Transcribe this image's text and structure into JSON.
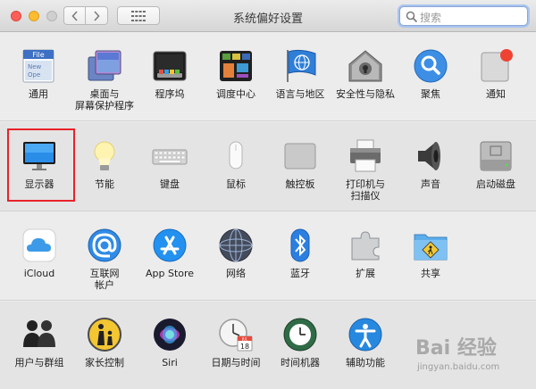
{
  "window": {
    "title": "系统偏好设置"
  },
  "toolbar": {
    "search_placeholder": "搜索"
  },
  "sections": [
    [
      {
        "label": "通用",
        "icon": "general-icon"
      },
      {
        "label": "桌面与\n屏幕保护程序",
        "icon": "desktop-screensaver-icon"
      },
      {
        "label": "程序坞",
        "icon": "dock-icon"
      },
      {
        "label": "调度中心",
        "icon": "mission-control-icon"
      },
      {
        "label": "语言与地区",
        "icon": "language-region-icon"
      },
      {
        "label": "安全性与隐私",
        "icon": "security-privacy-icon"
      },
      {
        "label": "聚焦",
        "icon": "spotlight-icon"
      },
      {
        "label": "通知",
        "icon": "notifications-icon"
      }
    ],
    [
      {
        "label": "显示器",
        "icon": "displays-icon"
      },
      {
        "label": "节能",
        "icon": "energy-saver-icon"
      },
      {
        "label": "键盘",
        "icon": "keyboard-icon"
      },
      {
        "label": "鼠标",
        "icon": "mouse-icon"
      },
      {
        "label": "触控板",
        "icon": "trackpad-icon"
      },
      {
        "label": "打印机与\n扫描仪",
        "icon": "printers-scanners-icon"
      },
      {
        "label": "声音",
        "icon": "sound-icon"
      },
      {
        "label": "启动磁盘",
        "icon": "startup-disk-icon"
      }
    ],
    [
      {
        "label": "iCloud",
        "icon": "icloud-icon"
      },
      {
        "label": "互联网\n帐户",
        "icon": "internet-accounts-icon"
      },
      {
        "label": "App Store",
        "icon": "app-store-icon"
      },
      {
        "label": "网络",
        "icon": "network-icon"
      },
      {
        "label": "蓝牙",
        "icon": "bluetooth-icon"
      },
      {
        "label": "扩展",
        "icon": "extensions-icon"
      },
      {
        "label": "共享",
        "icon": "sharing-icon"
      }
    ],
    [
      {
        "label": "用户与群组",
        "icon": "users-groups-icon"
      },
      {
        "label": "家长控制",
        "icon": "parental-controls-icon"
      },
      {
        "label": "Siri",
        "icon": "siri-icon"
      },
      {
        "label": "日期与时间",
        "icon": "date-time-icon"
      },
      {
        "label": "时间机器",
        "icon": "time-machine-icon"
      },
      {
        "label": "辅助功能",
        "icon": "accessibility-icon"
      }
    ]
  ],
  "date_icon": {
    "month": "JUL",
    "day": "18"
  },
  "watermark": {
    "text": "Bai 经验",
    "sub": "jingyan.baidu.com"
  }
}
